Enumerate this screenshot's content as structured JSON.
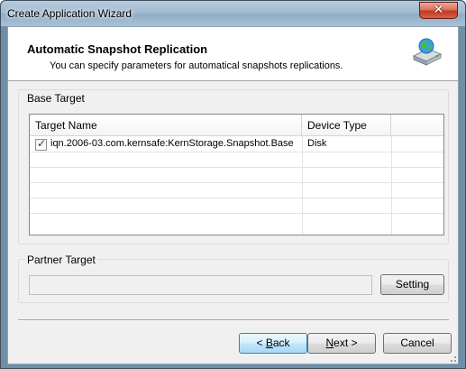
{
  "window": {
    "title": "Create Application Wizard",
    "close_glyph": "✕"
  },
  "header": {
    "title": "Automatic Snapshot Replication",
    "subtitle": "You can specify parameters for automatical snapshots replications.",
    "icon": "disk-sync-icon"
  },
  "base_target": {
    "label": "Base Target",
    "columns": [
      "Target Name",
      "Device Type"
    ],
    "rows": [
      {
        "checked": true,
        "target_name": "iqn.2006-03.com.kernsafe:KernStorage.Snapshot.Base",
        "device_type": "Disk"
      }
    ]
  },
  "partner_target": {
    "label": "Partner Target",
    "value": "",
    "setting_label": "Setting"
  },
  "buttons": {
    "back_prefix": "< ",
    "back_accel": "B",
    "back_rest": "ack",
    "next_accel": "N",
    "next_rest": "ext >",
    "cancel": "Cancel"
  },
  "colors": {
    "titlebar": "#a2bbd1",
    "close": "#c43a20",
    "focus_button": "#bee6fd"
  }
}
